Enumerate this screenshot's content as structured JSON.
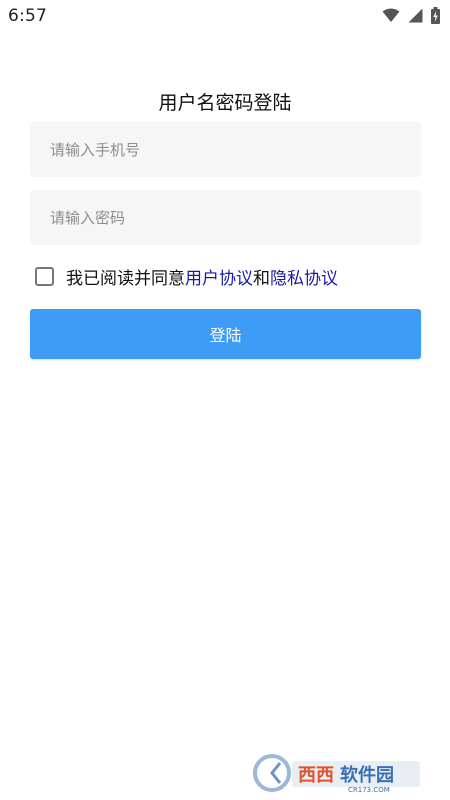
{
  "status_bar": {
    "time": "6:57",
    "icons": [
      "wifi-icon",
      "signal-icon",
      "battery-icon"
    ]
  },
  "login": {
    "title": "用户名密码登陆",
    "phone_placeholder": "请输入手机号",
    "password_placeholder": "请输入密码",
    "agreement": {
      "checked": false,
      "prefix": "我已阅读并同意",
      "user_agreement": "用户协议",
      "conjunction": "和",
      "privacy_agreement": "隐私协议"
    },
    "login_button": "登陆"
  },
  "colors": {
    "button": "#3f9cf6",
    "link": "#1a1aa8",
    "input_bg": "#f6f6f6"
  },
  "watermark": {
    "text": "西西软件园",
    "subtext": "CR173.COM"
  }
}
